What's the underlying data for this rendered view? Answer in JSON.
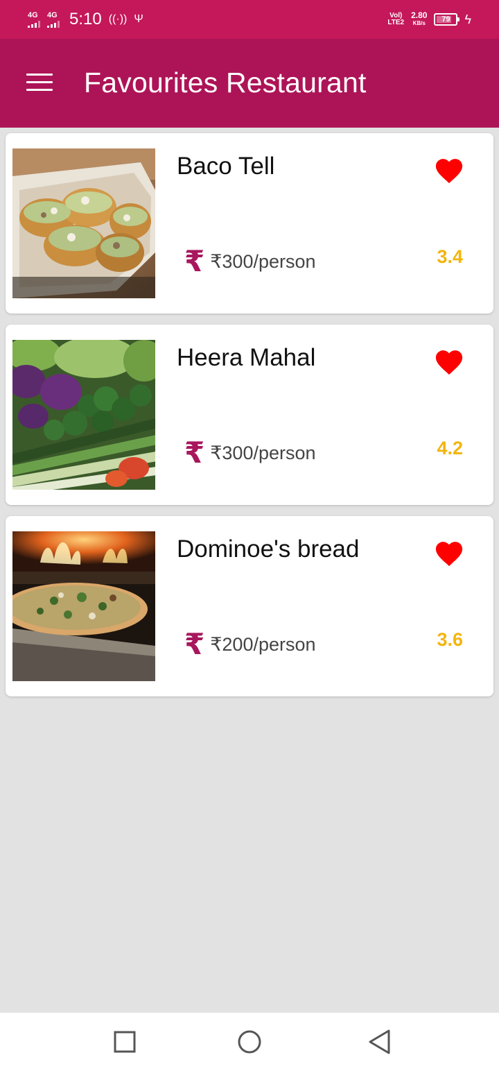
{
  "status_bar": {
    "net1": "4G",
    "net2": "4G",
    "time": "5:10",
    "hotspot_icon": "hotspot-icon",
    "usb_icon": "usb-icon",
    "volte_top": "Vol)",
    "volte_bottom": "LTE2",
    "speed_value": "2.80",
    "speed_unit": "KB/s",
    "battery_level": "79",
    "battery_fraction": 0.79
  },
  "app_bar": {
    "title": "Favourites Restaurant",
    "menu_icon": "hamburger-menu-icon"
  },
  "colors": {
    "status_bar": "#c4185a",
    "app_bar": "#ad1457",
    "accent": "#a8175d",
    "rating": "#f3b50d",
    "heart": "#ff0000",
    "background": "#e2e2e2"
  },
  "restaurants": [
    {
      "name": "Baco Tell",
      "price": "₹300/person",
      "rating": "3.4",
      "favourite": true,
      "image": "tacos-photo"
    },
    {
      "name": "Heera Mahal",
      "price": "₹300/person",
      "rating": "4.2",
      "favourite": true,
      "image": "vegetables-photo"
    },
    {
      "name": "Dominoe's bread",
      "price": "₹200/person",
      "rating": "3.6",
      "favourite": true,
      "image": "pizza-photo"
    }
  ],
  "currency_symbol": "₹",
  "nav_bar": {
    "recents_icon": "square-recents-icon",
    "home_icon": "circle-home-icon",
    "back_icon": "triangle-back-icon"
  }
}
